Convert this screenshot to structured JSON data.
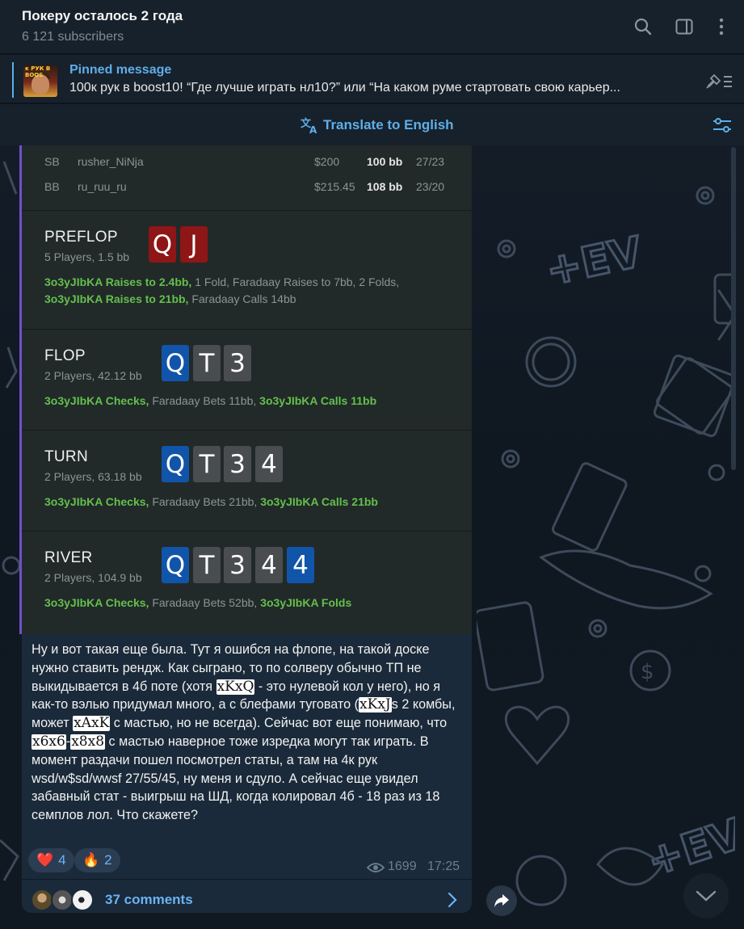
{
  "header": {
    "title": "Покеру осталось 2 года",
    "subscribers": "6 121 subscribers"
  },
  "pinned": {
    "label": "Pinned message",
    "text": "100к рук в boost10!  “Где лучше играть нл10?” или “На каком руме стартовать свою карьер...",
    "thumb_text": "к РУК В BOOS"
  },
  "translate": {
    "label": "Translate to English"
  },
  "hand": {
    "positions": [
      {
        "pos": "SB",
        "name": "rusher_NiNja",
        "stack": "$200",
        "bb": "100 bb",
        "stat": "27/23"
      },
      {
        "pos": "BB",
        "name": "ru_ruu_ru",
        "stack": "$215.45",
        "bb": "108 bb",
        "stat": "23/20"
      }
    ],
    "streets": [
      {
        "name": "PREFLOP",
        "sub": "5 Players, 1.5 bb",
        "cards": [
          {
            "v": "Q",
            "c": "red"
          },
          {
            "v": "J",
            "c": "red"
          }
        ],
        "line1": [
          {
            "t": "3o3yJIbKA Raises to 2.4bb,",
            "g": true
          },
          {
            "t": " 1 Fold, Faradaay Raises to 7bb, 2 Folds,",
            "g": false
          }
        ],
        "line2": [
          {
            "t": "3o3yJIbKA Raises to 21bb,",
            "g": true
          },
          {
            "t": " Faradaay Calls 14bb",
            "g": false
          }
        ]
      },
      {
        "name": "FLOP",
        "sub": "2 Players, 42.12 bb",
        "cards": [
          {
            "v": "Q",
            "c": "blue"
          },
          {
            "v": "T",
            "c": "gray"
          },
          {
            "v": "3",
            "c": "gray"
          }
        ],
        "line1": [
          {
            "t": "3o3yJIbKA Checks,",
            "g": true
          },
          {
            "t": " Faradaay Bets 11bb, ",
            "g": false
          },
          {
            "t": "3o3yJIbKA Calls 11bb",
            "g": true
          }
        ]
      },
      {
        "name": "TURN",
        "sub": "2 Players, 63.18 bb",
        "cards": [
          {
            "v": "Q",
            "c": "blue"
          },
          {
            "v": "T",
            "c": "gray"
          },
          {
            "v": "3",
            "c": "gray"
          },
          {
            "v": "4",
            "c": "gray"
          }
        ],
        "line1": [
          {
            "t": "3o3yJIbKA Checks,",
            "g": true
          },
          {
            "t": " Faradaay Bets 21bb, ",
            "g": false
          },
          {
            "t": "3o3yJIbKA Calls 21bb",
            "g": true
          }
        ]
      },
      {
        "name": "RIVER",
        "sub": "2 Players, 104.9 bb",
        "cards": [
          {
            "v": "Q",
            "c": "blue"
          },
          {
            "v": "T",
            "c": "gray"
          },
          {
            "v": "3",
            "c": "gray"
          },
          {
            "v": "4",
            "c": "gray"
          },
          {
            "v": "4",
            "c": "blue"
          }
        ],
        "line1": [
          {
            "t": "3o3yJIbKA Checks,",
            "g": true
          },
          {
            "t": " Faradaay Bets 52bb, ",
            "g": false
          },
          {
            "t": "3o3yJIbKA Folds",
            "g": true
          }
        ]
      }
    ]
  },
  "message": {
    "parts": [
      {
        "t": "Ну и вот такая еще была. Тут я ошибся на флопе, на такой доске нужно ставить рендж. Как сыграно, то по солверу обычно ТП не выкидывается в 4б поте (хотя ",
        "tag": false
      },
      {
        "t": "xKxQ",
        "tag": true
      },
      {
        "t": " - это нулевой кол у него), но я как-то вэлью придумал много, а с блефами туговато (",
        "tag": false
      },
      {
        "t": "xKxJ",
        "tag": true
      },
      {
        "t": "s 2 комбы, может ",
        "tag": false
      },
      {
        "t": "xAxK",
        "tag": true
      },
      {
        "t": " с мастью, но не всегда). Сейчас вот еще понимаю, что ",
        "tag": false
      },
      {
        "t": "x6x6",
        "tag": true
      },
      {
        "t": "-",
        "tag": false
      },
      {
        "t": "x8x8",
        "tag": true
      },
      {
        "t": " с мастью наверное тоже изредка могут так играть. В момент раздачи пошел посмотрел статы, а там на 4к рук wsd/w$sd/wwsf 27/55/45, ну меня и сдуло. А сейчас еще увидел забавный стат - выигрыш на ШД, когда колировал 4б - 18 раз из 18 семплов лол. Что скажете?",
        "tag": false
      }
    ],
    "reactions": [
      {
        "emoji": "❤️",
        "count": "4"
      },
      {
        "emoji": "🔥",
        "count": "2"
      }
    ],
    "views": "1699",
    "time": "17:25",
    "comments": "37 comments"
  },
  "colors": {
    "accent": "#5eaeea",
    "green_action": "#63c04c",
    "card_red": "#8e1616",
    "card_blue": "#1155aa",
    "card_gray": "#4a4d50"
  }
}
